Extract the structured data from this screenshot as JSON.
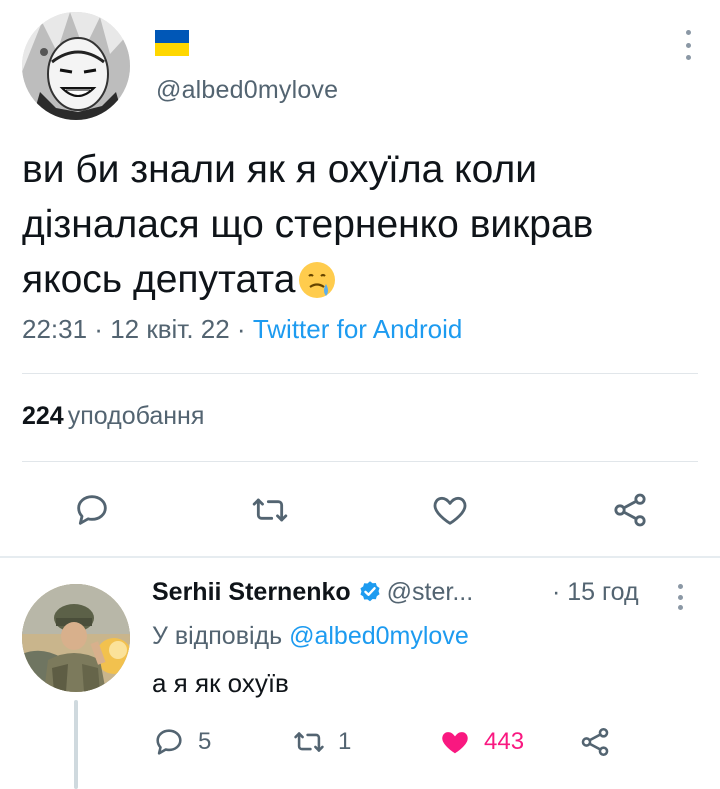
{
  "main_tweet": {
    "flag_colors": {
      "top": "#0057b7",
      "bottom": "#ffd700"
    },
    "handle": "@albed0mylove",
    "text_lines": [
      "ви би знали як я охуїла коли",
      "дізналася що стерненко викрав",
      "якось депутата"
    ],
    "emoji": "face-holding-back-tears-icon",
    "time": "22:31",
    "sep1": " · ",
    "date": "12 квіт. 22",
    "sep2": " · ",
    "source": "Twitter for Android",
    "likes_count": "224",
    "likes_label": "уподобання"
  },
  "reply": {
    "name": "Serhii Sternenko",
    "handle": "@ster...",
    "time": "· 15 год",
    "replying_to_prefix": "У відповідь",
    "replying_to_handle": "@albed0mylove",
    "text": "а я як охуїв",
    "reply_count": "5",
    "retweet_count": "1",
    "like_count": "443"
  },
  "colors": {
    "accent": "#1d9bf0",
    "like": "#f91880",
    "secondary_text": "#536471",
    "verified": "#1d9bf0"
  }
}
